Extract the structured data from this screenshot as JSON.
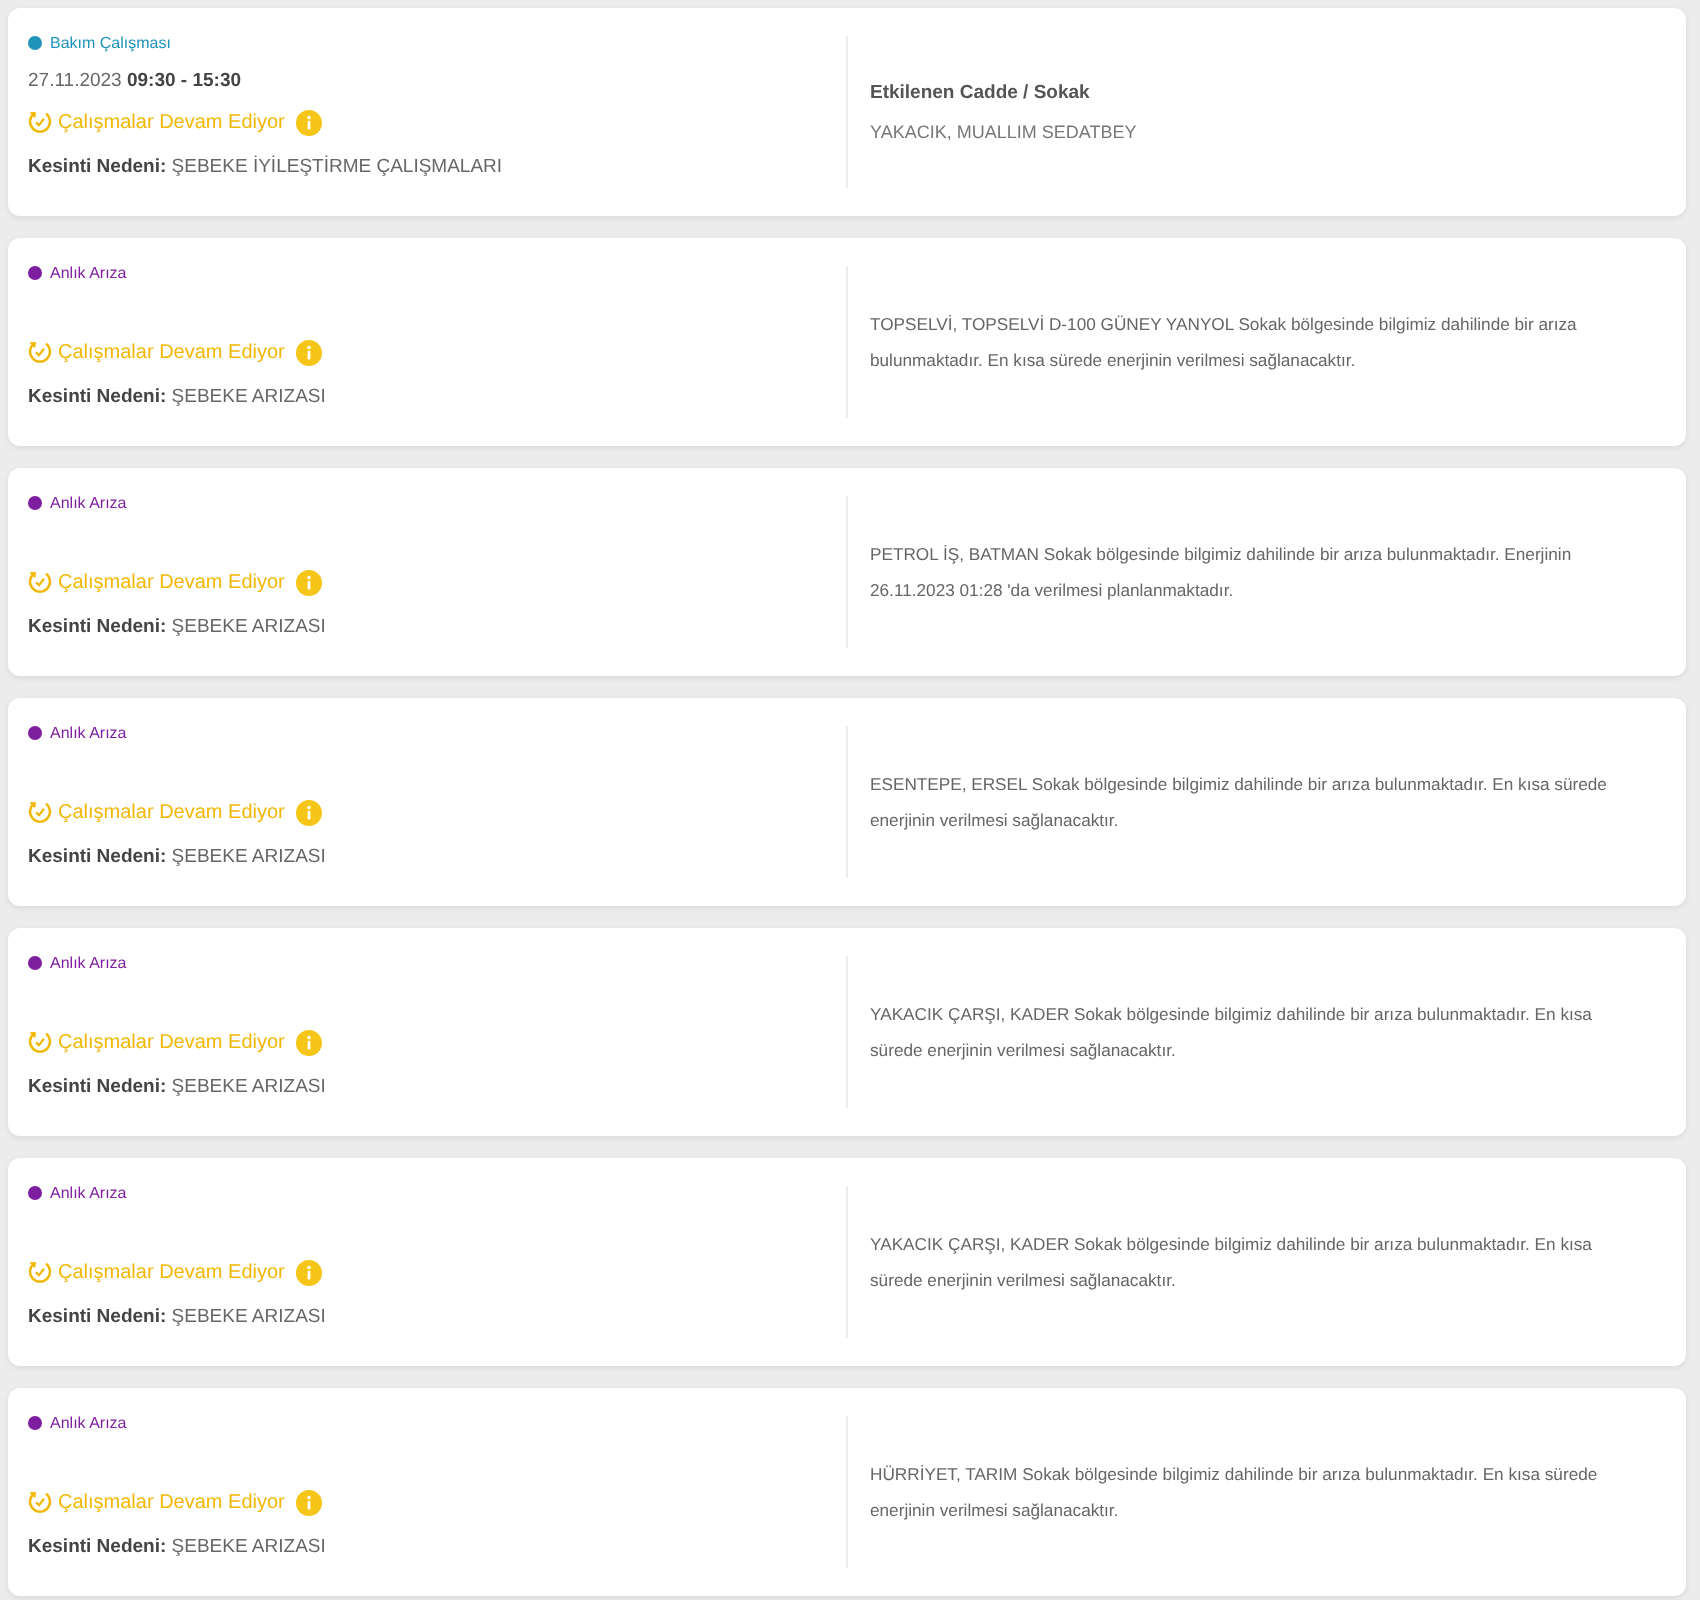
{
  "outages": [
    {
      "type_label": "Bakım Çalışması",
      "color": "#1f93b8",
      "date": "27.11.2023 **09:30 - 15:30**",
      "status": "Çalışmalar Devam Ediyor",
      "reason": "**Kesinti Nedeni:** ŞEBEKE İYİLEŞTİRME ÇALIŞMALARI",
      "affected": {
        "heading": "Etkilenen Cadde / Sokak",
        "value": "YAKACIK, MUALLIM SEDATBEY"
      }
    },
    {
      "type_label": "Anlık Arıza",
      "color": "#7e1fa0",
      "status": "Çalışmalar Devam Ediyor",
      "reason": "**Kesinti Nedeni:** ŞEBEKE ARIZASI",
      "description": "TOPSELVİ, TOPSELVİ D-100 GÜNEY YANYOL Sokak bölgesinde bilgimiz dahilinde bir arıza bulunmaktadır. En kısa sürede enerjinin verilmesi sağlanacaktır."
    },
    {
      "type_label": "Anlık Arıza",
      "color": "#7e1fa0",
      "status": "Çalışmalar Devam Ediyor",
      "reason": "**Kesinti Nedeni:** ŞEBEKE ARIZASI",
      "description": "PETROL İŞ, BATMAN Sokak bölgesinde bilgimiz dahilinde bir arıza bulunmaktadır. Enerjinin 26.11.2023 01:28 'da verilmesi planlanmaktadır."
    },
    {
      "type_label": "Anlık Arıza",
      "color": "#7e1fa0",
      "status": "Çalışmalar Devam Ediyor",
      "reason": "**Kesinti Nedeni:** ŞEBEKE ARIZASI",
      "description": "ESENTEPE, ERSEL Sokak bölgesinde bilgimiz dahilinde bir arıza bulunmaktadır. En kısa sürede enerjinin verilmesi sağlanacaktır."
    },
    {
      "type_label": "Anlık Arıza",
      "color": "#7e1fa0",
      "status": "Çalışmalar Devam Ediyor",
      "reason": "**Kesinti Nedeni:** ŞEBEKE ARIZASI",
      "description": "YAKACIK ÇARŞI, KADER Sokak bölgesinde bilgimiz dahilinde bir arıza bulunmaktadır. En kısa sürede enerjinin verilmesi sağlanacaktır."
    },
    {
      "type_label": "Anlık Arıza",
      "color": "#7e1fa0",
      "status": "Çalışmalar Devam Ediyor",
      "reason": "**Kesinti Nedeni:** ŞEBEKE ARIZASI",
      "description": "YAKACIK ÇARŞI, KADER Sokak bölgesinde bilgimiz dahilinde bir arıza bulunmaktadır. En kısa sürede enerjinin verilmesi sağlanacaktır."
    },
    {
      "type_label": "Anlık Arıza",
      "color": "#7e1fa0",
      "status": "Çalışmalar Devam Ediyor",
      "reason": "**Kesinti Nedeni:** ŞEBEKE ARIZASI",
      "description": "HÜRRİYET, TARIM Sokak bölgesinde bilgimiz dahilinde bir arıza bulunmaktadır. En kısa sürede enerjinin verilmesi sağlanacaktır."
    }
  ]
}
